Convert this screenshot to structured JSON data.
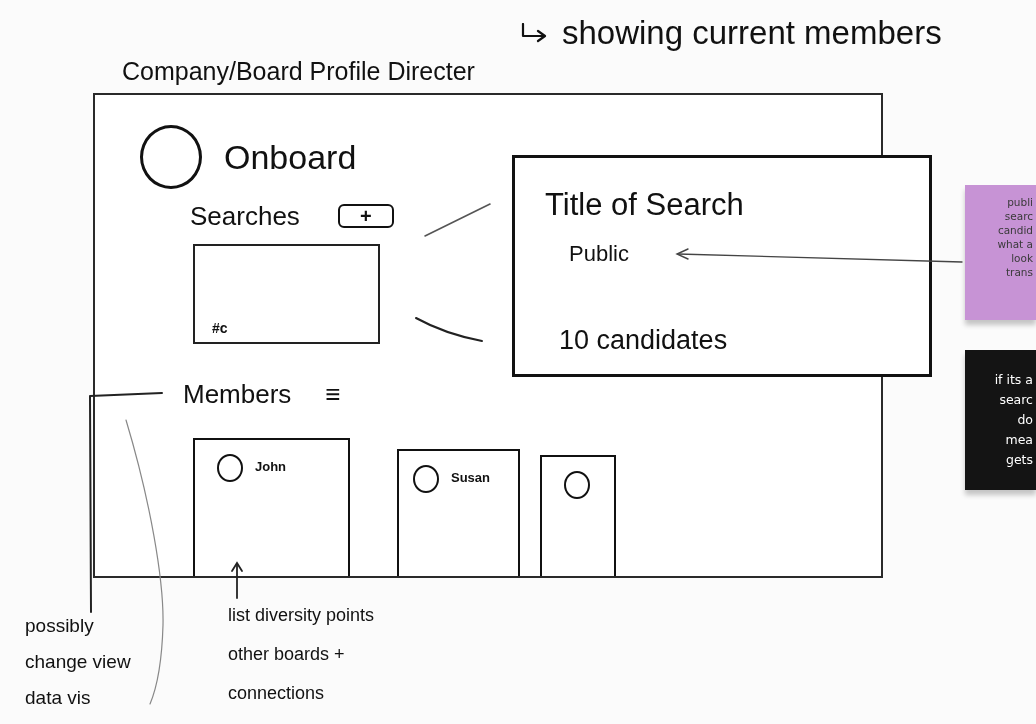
{
  "top_note": "showing current members",
  "page_title": "Company/Board Profile Directer",
  "app": {
    "brand": "Onboard",
    "searches": {
      "heading": "Searches",
      "add_button": "+",
      "cards": [
        {
          "tag": "#c"
        }
      ]
    },
    "members": {
      "heading": "Members",
      "view_button": "≡",
      "cards": [
        {
          "kind": "named",
          "name": "John"
        },
        {
          "kind": "named",
          "name": "Susan"
        },
        {
          "kind": "unnamed"
        }
      ]
    }
  },
  "search_detail": {
    "title": "Title of Search",
    "visibility": "Public",
    "candidates": "10 candidates"
  },
  "sticky_notes": [
    {
      "color": "#c793d5",
      "text": "publi\nsearc\ncandid\nwhat a\nlook\ntrans"
    },
    {
      "color": "#141414",
      "text": "if its a\nsearc\ndo\nmea\ngets"
    }
  ],
  "side_notes": {
    "view_note": "possibly\nchange view\ndata vis",
    "card_note": "list diversity points\nother boards +\nconnections"
  }
}
